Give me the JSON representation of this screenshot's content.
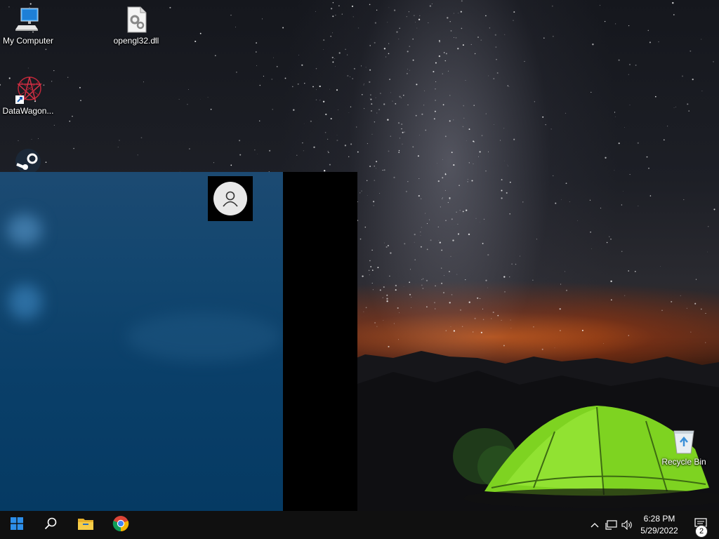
{
  "desktop": {
    "icons": [
      {
        "label": "My Computer",
        "icon": "computer-icon"
      },
      {
        "label": "opengl32.dll",
        "icon": "dll-file-icon"
      },
      {
        "label": "DataWagon...",
        "icon": "datawagon-shortcut-icon"
      },
      {
        "label": "",
        "icon": "steam-icon"
      },
      {
        "label": "Recycle Bin",
        "icon": "recycle-bin-icon"
      }
    ]
  },
  "start_menu": {
    "user_icon": "user-account-icon"
  },
  "taskbar": {
    "buttons": [
      {
        "icon": "windows-start-icon"
      },
      {
        "icon": "search-icon"
      },
      {
        "icon": "file-explorer-icon"
      },
      {
        "icon": "chrome-icon"
      }
    ],
    "tray": {
      "icons": [
        "chevron-up-icon",
        "network-icon",
        "volume-icon"
      ],
      "time": "6:28 PM",
      "date": "5/29/2022",
      "notification_count": "2"
    }
  },
  "colors": {
    "start_menu_bg": "#0a3f69",
    "taskbar_bg": "#101010",
    "tent_green": "#7ed321",
    "sunset_orange": "#d65c16"
  }
}
